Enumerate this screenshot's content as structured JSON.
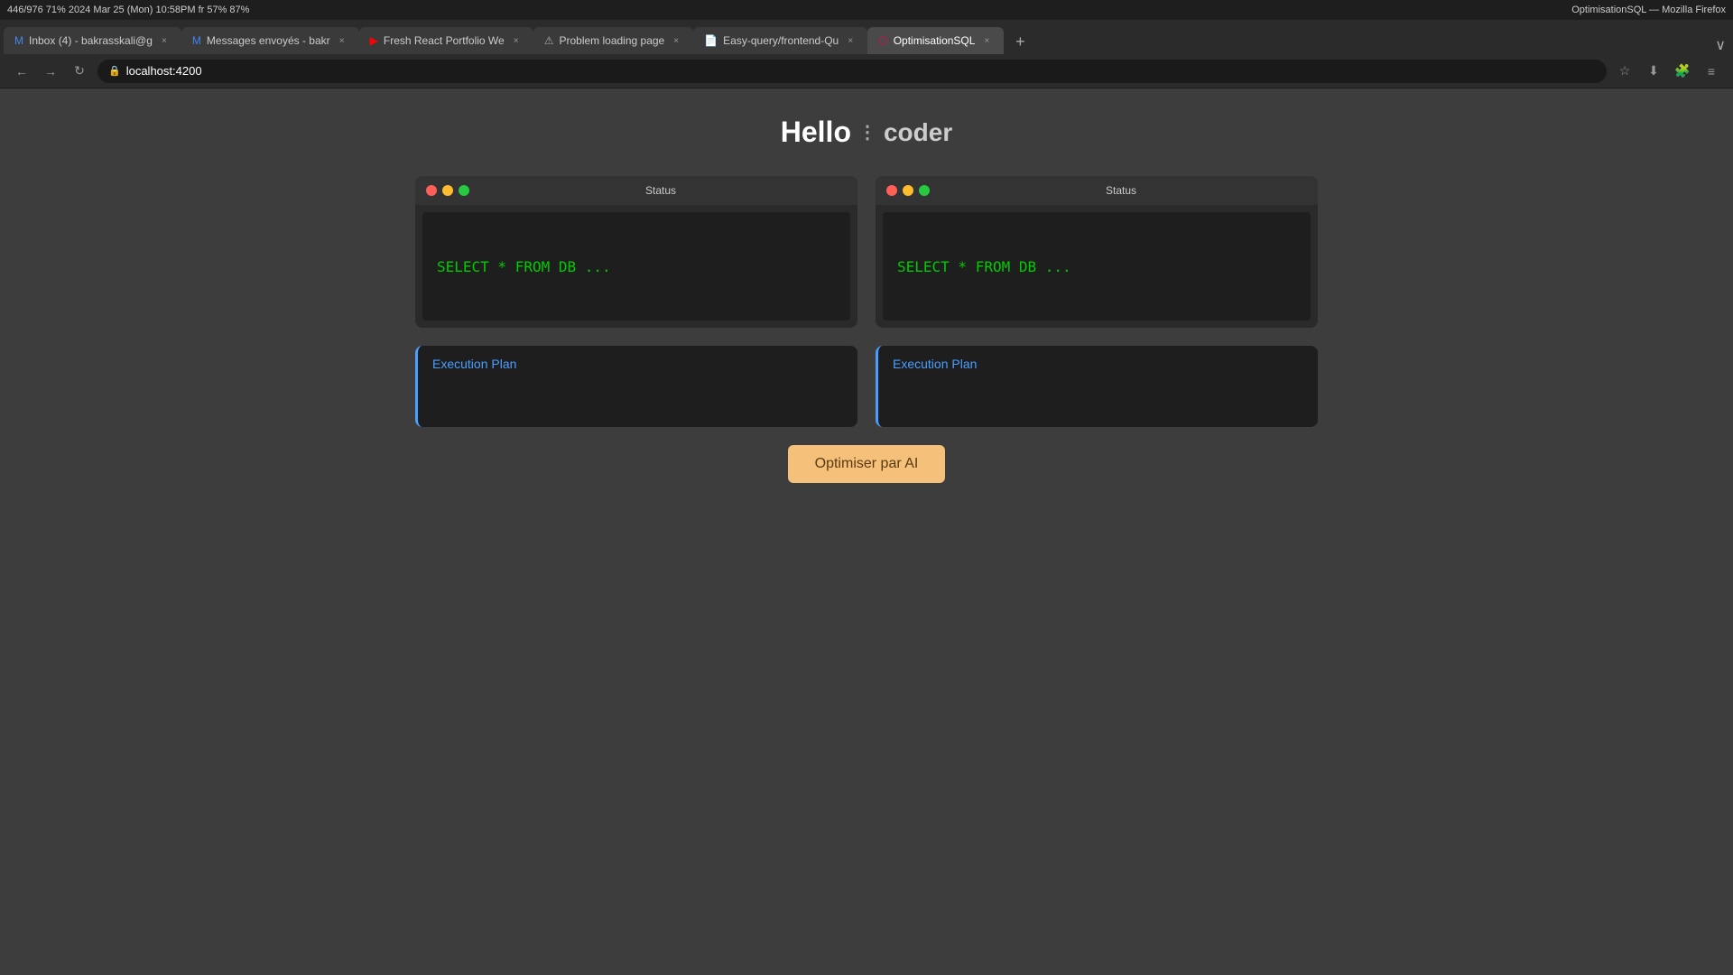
{
  "browser": {
    "topbar_text": "446/976  71%  2024 Mar 25 (Mon)  10:58PM  fr  57%  87%",
    "title": "OptimisationSQL — Mozilla Firefox",
    "url": "localhost:4200"
  },
  "tabs": [
    {
      "id": "tab1",
      "label": "Inbox (4) - bakrasskali@g",
      "icon": "mail-icon",
      "active": false,
      "closable": true
    },
    {
      "id": "tab2",
      "label": "Messages envoyés - bakr",
      "icon": "mail-icon",
      "active": false,
      "closable": true
    },
    {
      "id": "tab3",
      "label": "Fresh React Portfolio We",
      "icon": "youtube-icon",
      "active": false,
      "closable": true
    },
    {
      "id": "tab4",
      "label": "Problem loading page",
      "icon": "warning-icon",
      "active": false,
      "closable": true
    },
    {
      "id": "tab5",
      "label": "Easy-query/frontend-Qu",
      "icon": "page-icon",
      "active": false,
      "closable": true
    },
    {
      "id": "tab6",
      "label": "OptimisationSQL",
      "icon": "page-icon",
      "active": true,
      "closable": true
    }
  ],
  "page": {
    "greeting": "Hello",
    "animated_text": "coder",
    "menu_icon": "⋮"
  },
  "panels": [
    {
      "id": "panel1",
      "status_label": "Status",
      "sql_text": "SELECT * FROM DB ...",
      "execution_plan_label": "Execution Plan"
    },
    {
      "id": "panel2",
      "status_label": "Status",
      "sql_text": "SELECT * FROM DB ...",
      "execution_plan_label": "Execution Plan"
    }
  ],
  "optimize_button": {
    "label": "Optimiser par AI"
  },
  "traffic_lights": {
    "red": "#ff5f57",
    "yellow": "#febc2e",
    "green": "#28c840"
  }
}
